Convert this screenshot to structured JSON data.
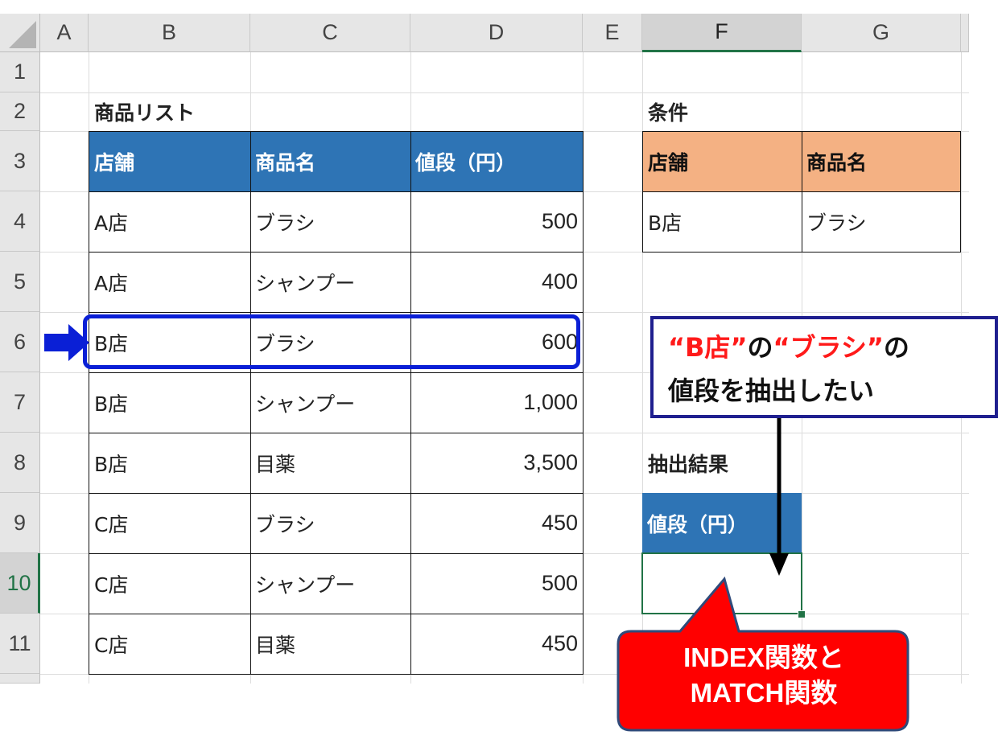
{
  "columns": [
    "A",
    "B",
    "C",
    "D",
    "E",
    "F",
    "G"
  ],
  "rows": [
    "1",
    "2",
    "3",
    "4",
    "5",
    "6",
    "7",
    "8",
    "9",
    "10",
    "11"
  ],
  "selected_column": "F",
  "selected_row": "10",
  "list": {
    "title": "商品リスト",
    "headers": [
      "店舗",
      "商品名",
      "値段（円）"
    ],
    "rows": [
      [
        "A店",
        "ブラシ",
        "500"
      ],
      [
        "A店",
        "シャンプー",
        "400"
      ],
      [
        "B店",
        "ブラシ",
        "600"
      ],
      [
        "B店",
        "シャンプー",
        "1,000"
      ],
      [
        "B店",
        "目薬",
        "3,500"
      ],
      [
        "C店",
        "ブラシ",
        "450"
      ],
      [
        "C店",
        "シャンプー",
        "500"
      ],
      [
        "C店",
        "目薬",
        "450"
      ]
    ]
  },
  "conditions": {
    "title": "条件",
    "headers": [
      "店舗",
      "商品名"
    ],
    "values": [
      "B店",
      "ブラシ"
    ]
  },
  "result": {
    "title": "抽出結果",
    "header": "値段（円）",
    "value": ""
  },
  "callout": {
    "quote_open_1": "“",
    "red_1": "B店",
    "quote_close_1": "”",
    "mid": "の",
    "quote_open_2": "“",
    "red_2": "ブラシ",
    "quote_close_2": "”",
    "end_1": "の",
    "line_2": "値段を抽出したい"
  },
  "bubble": {
    "line_1": "INDEX関数と",
    "line_2": "MATCH関数"
  },
  "colors": {
    "header_blue": "#2e74b5",
    "header_orange": "#f4b183",
    "highlight_blue": "#0a1fd6",
    "excel_green": "#217346",
    "callout_red": "#ff0000"
  }
}
